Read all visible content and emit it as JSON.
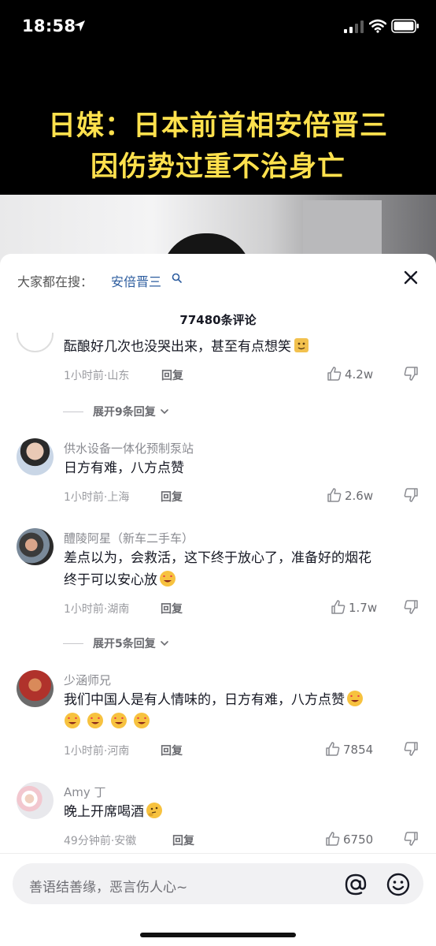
{
  "status_bar": {
    "time": "18:58"
  },
  "video": {
    "headline_line1": "日媒：日本前首相安倍晋三",
    "headline_line2": "因伤势过重不治身亡"
  },
  "sheet": {
    "hot_search_label": "大家都在搜：",
    "hot_search_term": "安倍晋三",
    "comment_count_title": "77480条评论"
  },
  "comments": [
    {
      "text": "酝酿好几次也没哭出来，甚至有点想笑",
      "time_location": "1小时前·山东",
      "reply": "回复",
      "likes": "4.2w",
      "expand": "展开9条回复"
    },
    {
      "username": "供水设备一体化预制泵站",
      "text": "日方有难，八方点赞",
      "time_location": "1小时前·上海",
      "reply": "回复",
      "likes": "2.6w"
    },
    {
      "username": "醴陵阿星（新车二手车）",
      "text_line1": "差点以为，会救活，这下终于放心了，准备好的烟花",
      "text_line2": "终于可以安心放",
      "time_location": "1小时前·湖南",
      "reply": "回复",
      "likes": "1.7w",
      "expand": "展开5条回复"
    },
    {
      "username": "少涵师兄",
      "text": "我们中国人是有人情味的，日方有难，八方点赞",
      "time_location": "1小时前·河南",
      "reply": "回复",
      "likes": "7854"
    },
    {
      "username": "Amy 丁",
      "text": "晚上开席喝酒",
      "time_location": "49分钟前·安徽",
      "reply": "回复",
      "likes": "6750"
    }
  ],
  "input": {
    "placeholder": "善语结善缘，恶言伤人心~"
  },
  "colors": {
    "headline": "#ffe14d",
    "link": "#2d5d9f",
    "muted": "#8a8b91",
    "text": "#161823"
  },
  "icons": [
    "location-arrow-icon",
    "signal-icon",
    "wifi-icon",
    "battery-icon",
    "search-icon",
    "close-icon",
    "thumbs-up-icon",
    "thumbs-down-icon",
    "chevron-down-icon",
    "at-icon",
    "emoji-icon"
  ]
}
